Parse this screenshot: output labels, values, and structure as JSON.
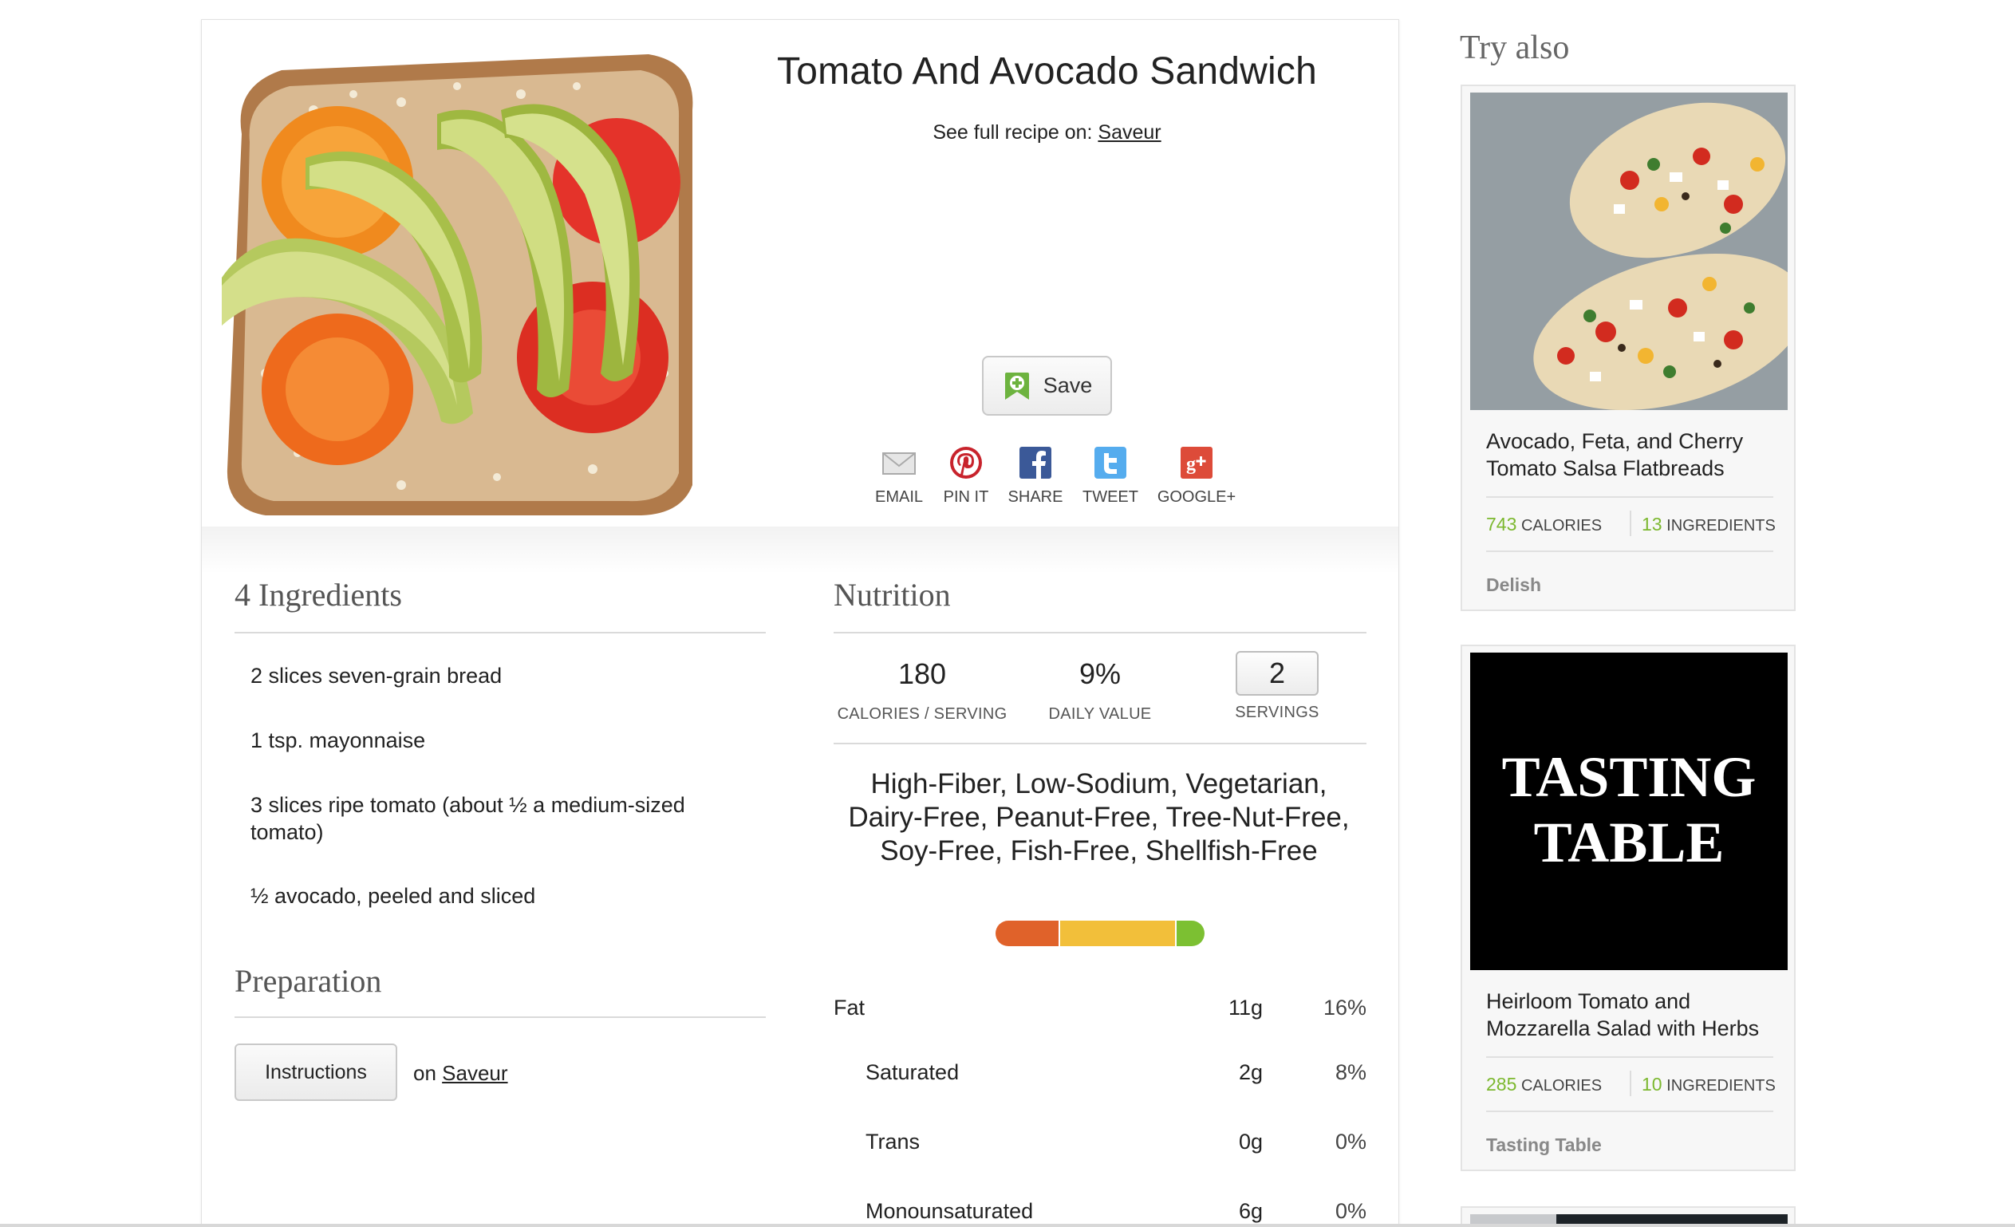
{
  "recipe": {
    "title": "Tomato And Avocado Sandwich",
    "source_prefix": "See full recipe on:",
    "source_name": "Saveur"
  },
  "actions": {
    "save_label": "Save",
    "share": [
      {
        "label": "EMAIL",
        "icon": "envelope-icon"
      },
      {
        "label": "PIN IT",
        "icon": "pinterest-icon"
      },
      {
        "label": "SHARE",
        "icon": "facebook-icon"
      },
      {
        "label": "TWEET",
        "icon": "twitter-icon"
      },
      {
        "label": "GOOGLE+",
        "icon": "google-plus-icon"
      }
    ]
  },
  "ingredients": {
    "heading": "4 Ingredients",
    "items": [
      "2 slices seven-grain bread",
      "1 tsp. mayonnaise",
      "3 slices ripe tomato (about ½ a medium-sized tomato)",
      "½ avocado, peeled and sliced"
    ]
  },
  "preparation": {
    "heading": "Preparation",
    "button_label": "Instructions",
    "on_prefix": "on",
    "source_name": "Saveur"
  },
  "nutrition": {
    "heading": "Nutrition",
    "calories": "180",
    "calories_caption": "CALORIES / SERVING",
    "daily_value": "9%",
    "daily_value_caption": "DAILY VALUE",
    "servings": "2",
    "servings_caption": "SERVINGS",
    "diet_labels": "High-Fiber, Low-Sodium, Vegetarian, Dairy-Free, Peanut-Free, Tree-Nut-Free, Soy-Free, Fish-Free, Shellfish-Free",
    "health_bar": {
      "segments": [
        {
          "fraction": 0.3,
          "color": "#e0622a"
        },
        {
          "fraction": 0.56,
          "color": "#f2bf3a"
        },
        {
          "fraction": 0.14,
          "color": "#7cc032"
        }
      ]
    },
    "rows": [
      {
        "name": "Fat",
        "amount": "11g",
        "percent": "16%",
        "sub": false
      },
      {
        "name": "Saturated",
        "amount": "2g",
        "percent": "8%",
        "sub": true
      },
      {
        "name": "Trans",
        "amount": "0g",
        "percent": "0%",
        "sub": true
      },
      {
        "name": "Monounsaturated",
        "amount": "6g",
        "percent": "0%",
        "sub": true
      }
    ]
  },
  "sidebar": {
    "heading": "Try also",
    "cards": [
      {
        "title": "Avocado, Feta, and Cherry Tomato Salsa Flatbreads",
        "calories": "743",
        "calories_label": "CALORIES",
        "ingredients": "13",
        "ingredients_label": "INGREDIENTS",
        "source": "Delish"
      },
      {
        "title": "Heirloom Tomato and Mozzarella Salad with Herbs",
        "calories": "285",
        "calories_label": "CALORIES",
        "ingredients": "10",
        "ingredients_label": "INGREDIENTS",
        "source": "Tasting Table",
        "logo_text": "Tasting Table"
      }
    ]
  },
  "colors": {
    "accent_green": "#7cb82f",
    "heading_gray": "#555555"
  }
}
